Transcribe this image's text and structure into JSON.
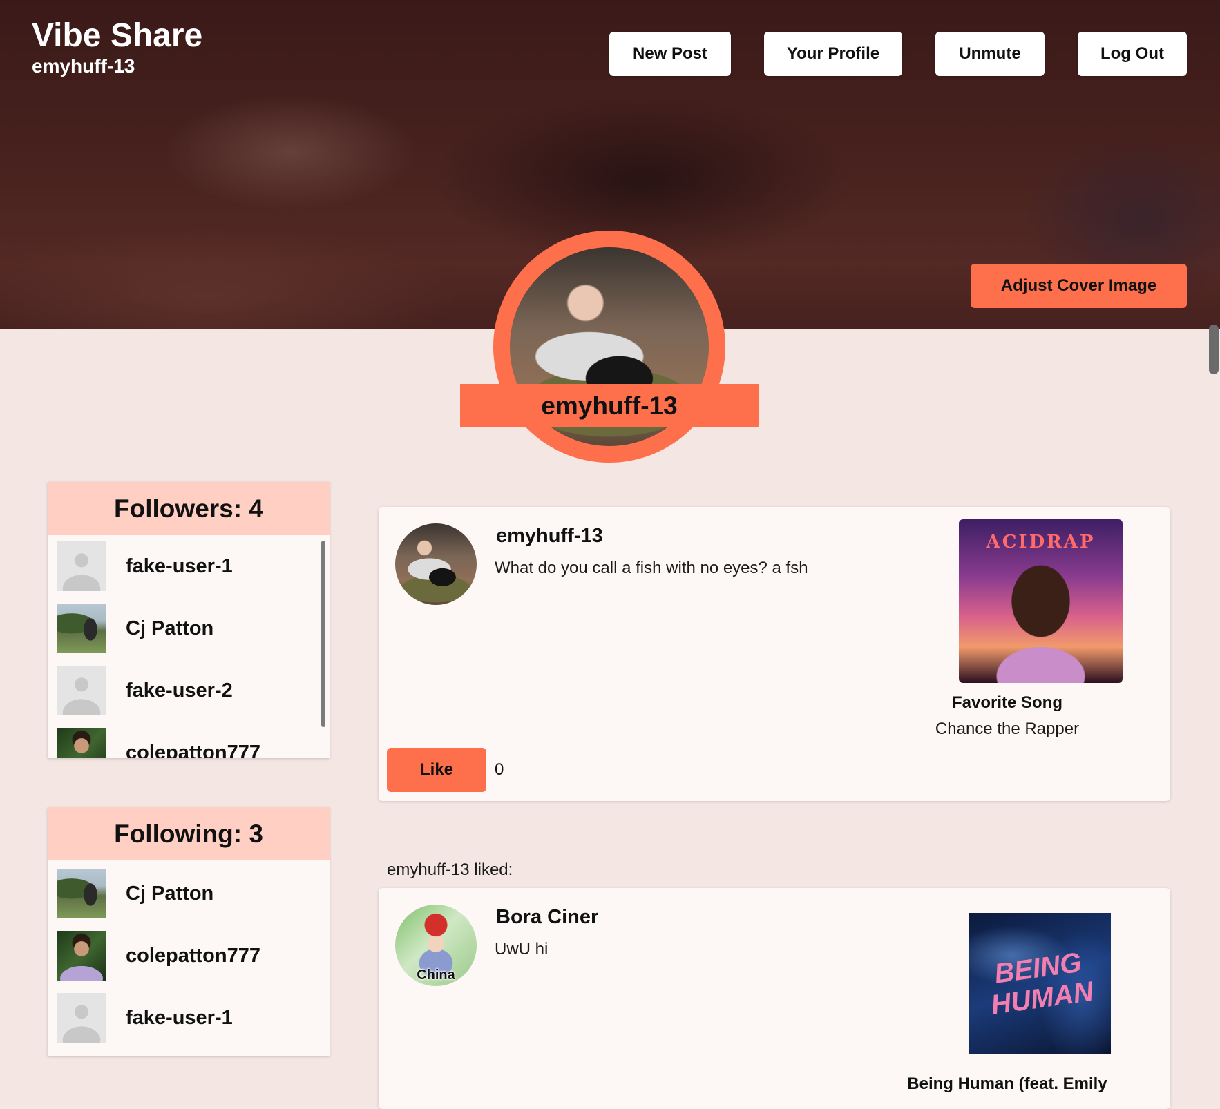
{
  "app": {
    "title": "Vibe Share",
    "current_user": "emyhuff-13"
  },
  "nav": {
    "new_post": "New Post",
    "your_profile": "Your Profile",
    "unmute": "Unmute",
    "log_out": "Log Out"
  },
  "cover": {
    "adjust_label": "Adjust Cover Image"
  },
  "profile": {
    "username": "emyhuff-13"
  },
  "followers": {
    "title": "Followers: 4",
    "users": [
      {
        "name": "fake-user-1",
        "avatar": "default-avatar"
      },
      {
        "name": "Cj Patton",
        "avatar": "park-photo"
      },
      {
        "name": "fake-user-2",
        "avatar": "default-avatar"
      },
      {
        "name": "colepatton777",
        "avatar": "person-photo"
      }
    ]
  },
  "following": {
    "title": "Following: 3",
    "users": [
      {
        "name": "Cj Patton",
        "avatar": "park-photo"
      },
      {
        "name": "colepatton777",
        "avatar": "person-photo"
      },
      {
        "name": "fake-user-1",
        "avatar": "default-avatar"
      }
    ]
  },
  "posts": [
    {
      "author": "emyhuff-13",
      "text": "What do you call a fish with no eyes? a fsh",
      "album_art_text": "ACIDRAP",
      "song_label": "Favorite Song",
      "song_artist": "Chance the Rapper",
      "like_label": "Like",
      "likes": "0"
    },
    {
      "liked_caption": "emyhuff-13 liked:",
      "author": "Bora Ciner",
      "text": "UwU hi",
      "avatar_badge": "China",
      "album_art_text": "BEING HUMAN",
      "song_title": "Being Human (feat. Emily"
    }
  ],
  "colors": {
    "accent": "#fe6f4b",
    "panel_header": "#fecfc2",
    "page_bg": "#f4e6e3",
    "card_bg": "#fdf7f6"
  }
}
